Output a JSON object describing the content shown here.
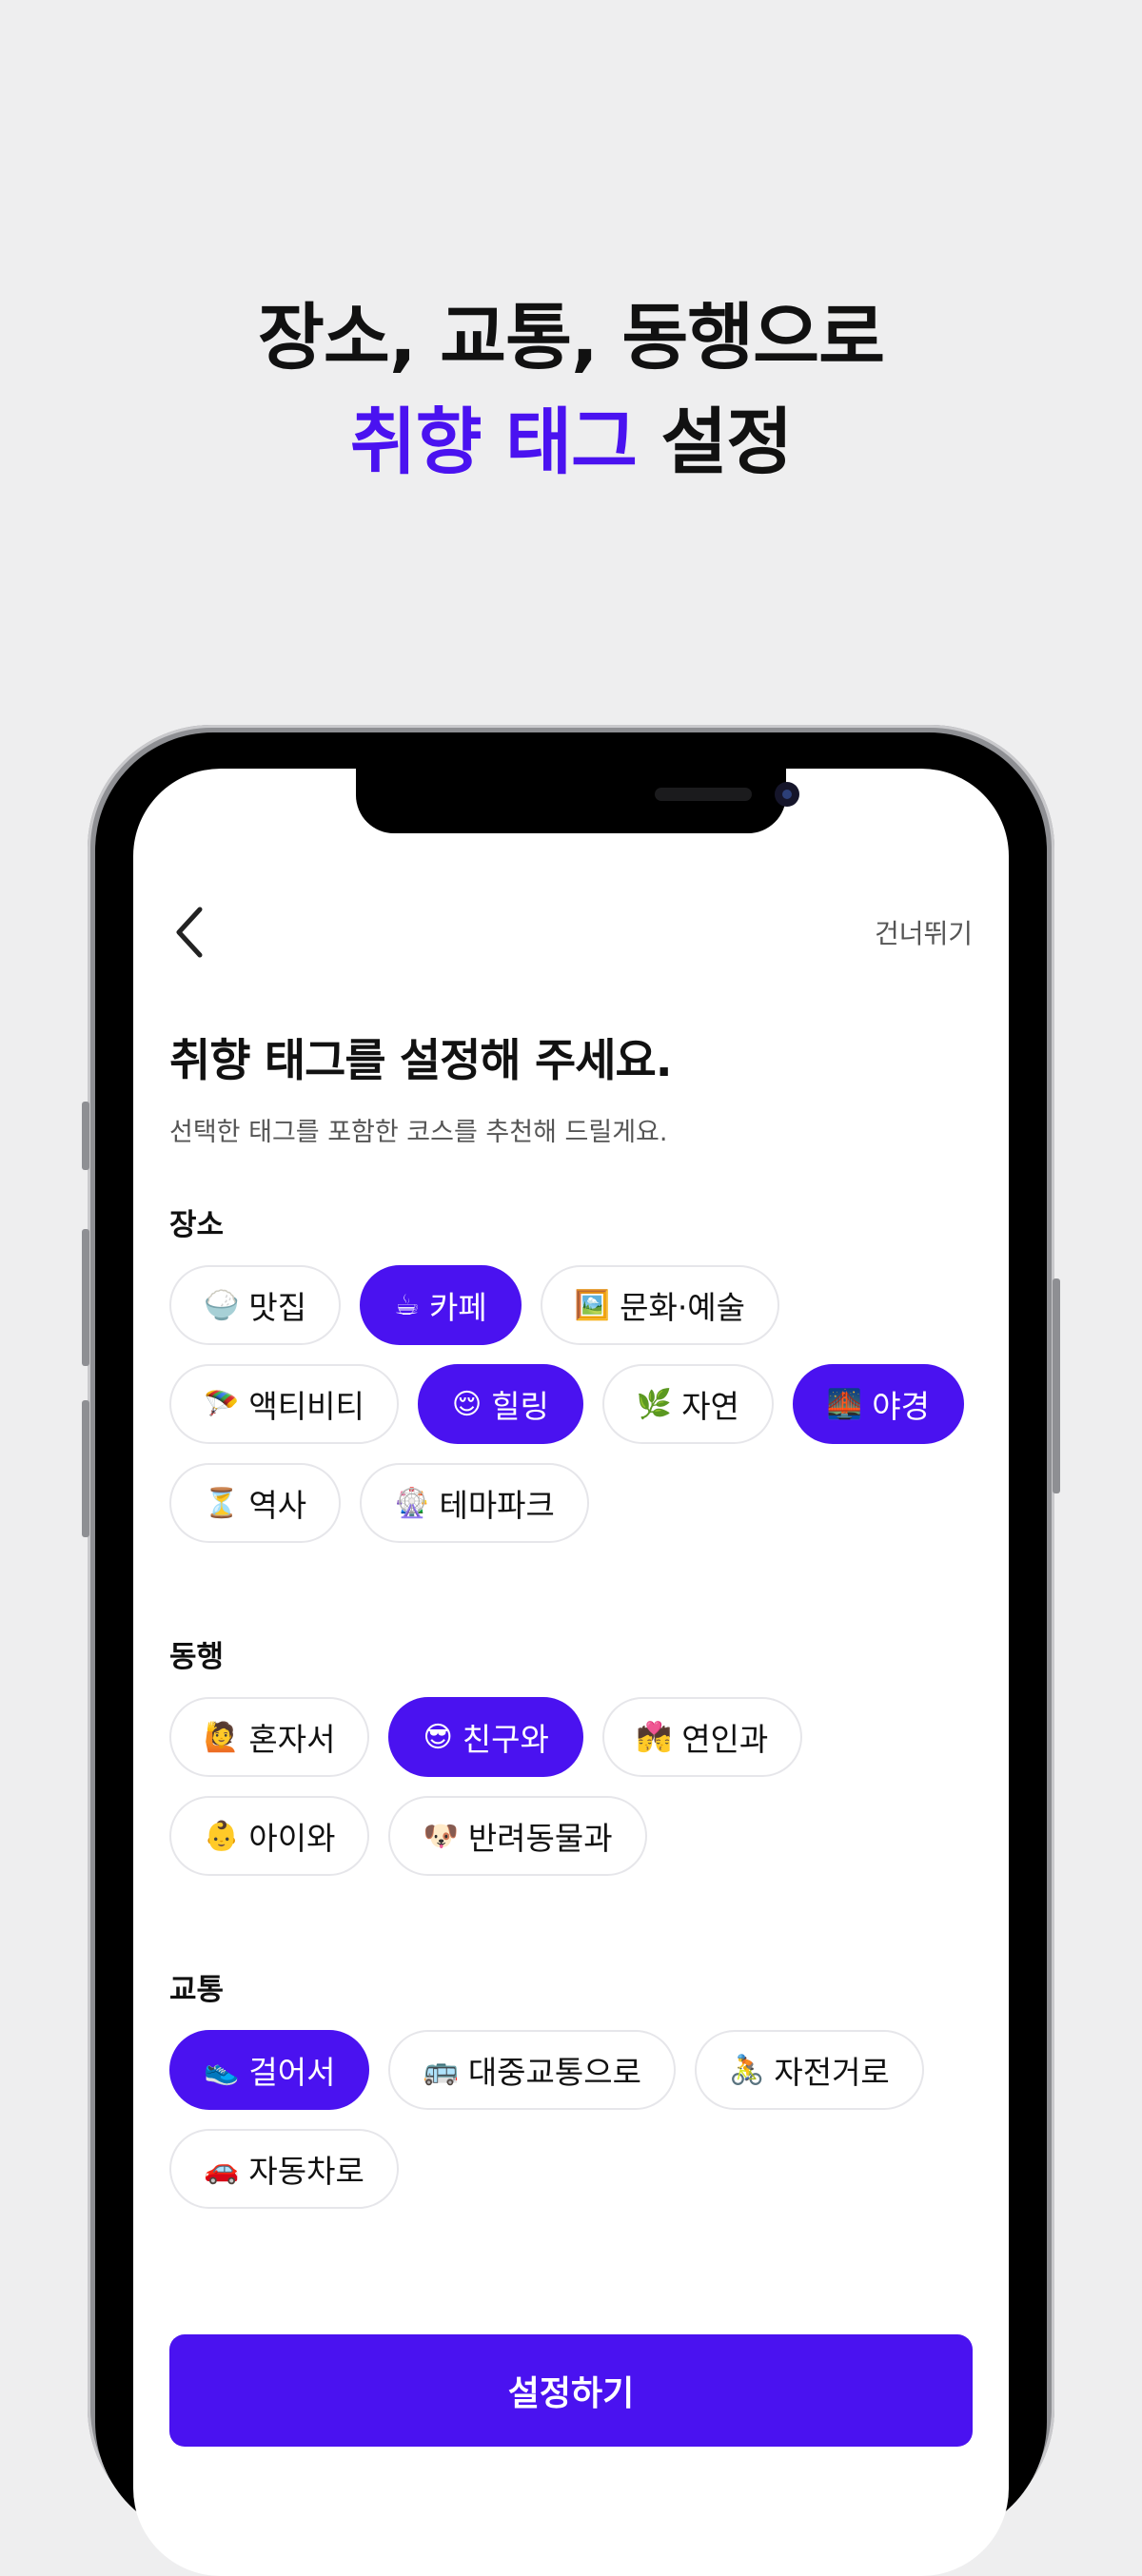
{
  "headline": {
    "line1": "장소, 교통, 동행으로",
    "accent": "취향 태그",
    "rest": "설정"
  },
  "colors": {
    "accent": "#4a12f0",
    "chip_border": "#e6e6ea"
  },
  "nav": {
    "back_icon": "chevron-left-icon",
    "skip_label": "건너뛰기"
  },
  "title": "취향 태그를 설정해 주세요.",
  "subtitle": "선택한 태그를 포함한 코스를 추천해 드릴게요.",
  "sections": [
    {
      "label": "장소",
      "tags": [
        {
          "emoji": "🍚",
          "label": "맛집",
          "selected": false
        },
        {
          "emoji": "☕",
          "label": "카페",
          "selected": true
        },
        {
          "emoji": "🖼️",
          "label": "문화·예술",
          "selected": false
        },
        {
          "emoji": "🪂",
          "label": "액티비티",
          "selected": false
        },
        {
          "emoji": "😌",
          "label": "힐링",
          "selected": true
        },
        {
          "emoji": "🌿",
          "label": "자연",
          "selected": false
        },
        {
          "emoji": "🌉",
          "label": "야경",
          "selected": true
        },
        {
          "emoji": "⏳",
          "label": "역사",
          "selected": false
        },
        {
          "emoji": "🎡",
          "label": "테마파크",
          "selected": false
        }
      ]
    },
    {
      "label": "동행",
      "tags": [
        {
          "emoji": "🙋",
          "label": "혼자서",
          "selected": false
        },
        {
          "emoji": "😎",
          "label": "친구와",
          "selected": true
        },
        {
          "emoji": "💏",
          "label": "연인과",
          "selected": false
        },
        {
          "emoji": "👶",
          "label": "아이와",
          "selected": false
        },
        {
          "emoji": "🐶",
          "label": "반려동물과",
          "selected": false
        }
      ]
    },
    {
      "label": "교통",
      "tags": [
        {
          "emoji": "👟",
          "label": "걸어서",
          "selected": true
        },
        {
          "emoji": "🚌",
          "label": "대중교통으로",
          "selected": false
        },
        {
          "emoji": "🚴",
          "label": "자전거로",
          "selected": false
        },
        {
          "emoji": "🚗",
          "label": "자동차로",
          "selected": false
        }
      ]
    }
  ],
  "submit_label": "설정하기"
}
